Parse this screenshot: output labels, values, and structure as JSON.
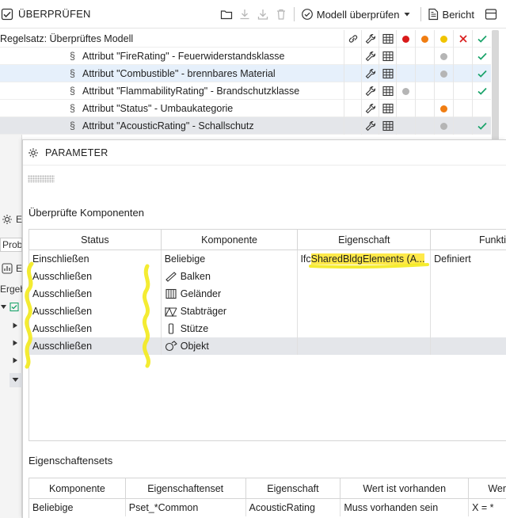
{
  "toolbar": {
    "title": "ÜBERPRÜFEN",
    "check_model_label": "Modell überprüfen",
    "report_label": "Bericht"
  },
  "ruleset": {
    "header": "Regelsatz: Überprüftes Modell",
    "rules": [
      {
        "label": "Attribut \"FireRating\" - Feuerwiderstandsklasse",
        "dots": [
          "",
          "",
          "grey",
          "",
          "check"
        ]
      },
      {
        "label": "Attribut \"Combustible\" - brennbares Material",
        "dots": [
          "",
          "",
          "grey",
          "",
          "check"
        ]
      },
      {
        "label": "Attribut \"FlammabilityRating\" - Brandschutzklasse",
        "dots": [
          "grey",
          "",
          "",
          "",
          "check"
        ]
      },
      {
        "label": "Attribut \"Status\" - Umbaukategorie",
        "dots": [
          "",
          "",
          "orange",
          "",
          ""
        ]
      },
      {
        "label": "Attribut \"AcousticRating\" - Schallschutz",
        "dots": [
          "",
          "",
          "grey",
          "",
          "check"
        ]
      }
    ],
    "header_dot_colors": {
      "red": "#d91a1a",
      "orange": "#f07d12",
      "yellow": "#f0c400",
      "grey": "#b5b5b5",
      "check": "#1aa36a",
      "cross": "#d91a1a"
    }
  },
  "behind": {
    "labels": [
      "E",
      "Probl",
      "E",
      "Ergeb"
    ]
  },
  "dialog": {
    "title": "PARAMETER",
    "components_section": "Überprüfte Komponenten",
    "components_columns": [
      "Status",
      "Komponente",
      "Eigenschaft",
      "Funkti"
    ],
    "components_rows": [
      {
        "status": "Einschließen",
        "component": "Beliebige",
        "icon": "",
        "property_prefix": "Ifc",
        "property_highlight": "SharedBldgElements (A...",
        "function": "Definiert"
      },
      {
        "status": "Ausschließen",
        "component": "Balken",
        "icon": "beam-icon",
        "property_prefix": "",
        "property_highlight": "",
        "function": ""
      },
      {
        "status": "Ausschließen",
        "component": "Geländer",
        "icon": "railing-icon",
        "property_prefix": "",
        "property_highlight": "",
        "function": ""
      },
      {
        "status": "Ausschließen",
        "component": "Stabträger",
        "icon": "truss-icon",
        "property_prefix": "",
        "property_highlight": "",
        "function": ""
      },
      {
        "status": "Ausschließen",
        "component": "Stütze",
        "icon": "column-icon",
        "property_prefix": "",
        "property_highlight": "",
        "function": ""
      },
      {
        "status": "Ausschließen",
        "component": "Objekt",
        "icon": "object-icon",
        "property_prefix": "",
        "property_highlight": "",
        "function": ""
      }
    ],
    "psets_section": "Eigenschaftensets",
    "psets_columns": [
      "Komponente",
      "Eigenschaftenset",
      "Eigenschaft",
      "Wert ist vorhanden",
      "Wer"
    ],
    "psets_rows": [
      {
        "component": "Beliebige",
        "pset": "Pset_*Common",
        "property": "AcousticRating",
        "exists": "Muss vorhanden sein",
        "value": "X = *"
      }
    ]
  }
}
